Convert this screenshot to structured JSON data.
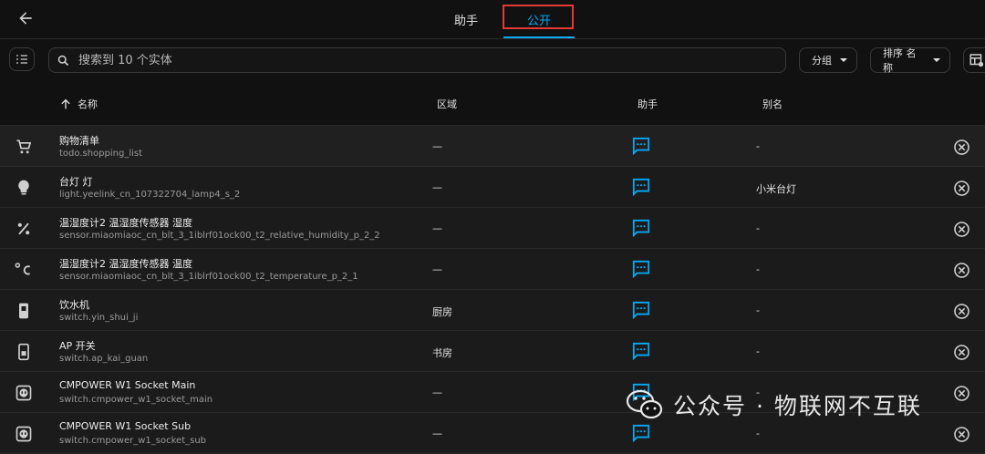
{
  "tabs": [
    {
      "label": "助手"
    },
    {
      "label": "公开"
    }
  ],
  "search": {
    "placeholder": "搜索到 10 个实体",
    "value": ""
  },
  "group_label": "分组",
  "sort_label": "排序 名称",
  "columns": {
    "name": "名称",
    "area": "区域",
    "assistant": "助手",
    "alias": "别名"
  },
  "rows": [
    {
      "icon": "cart-icon",
      "name": "购物清单",
      "entity_id": "todo.shopping_list",
      "area": "—",
      "alias": "-"
    },
    {
      "icon": "lightbulb-icon",
      "name": "台灯 灯",
      "entity_id": "light.yeelink_cn_107322704_lamp4_s_2",
      "area": "—",
      "alias": "小米台灯"
    },
    {
      "icon": "percent-icon",
      "name": "温湿度计2 温湿度传感器 湿度",
      "entity_id": "sensor.miaomiaoc_cn_blt_3_1iblrf01ock00_t2_relative_humidity_p_2_2",
      "area": "—",
      "alias": "-"
    },
    {
      "icon": "celsius-icon",
      "name": "温湿度计2 温湿度传感器 温度",
      "entity_id": "sensor.miaomiaoc_cn_blt_3_1iblrf01ock00_t2_temperature_p_2_1",
      "area": "—",
      "alias": "-"
    },
    {
      "icon": "switch-icon",
      "name": "饮水机",
      "entity_id": "switch.yin_shui_ji",
      "area": "厨房",
      "alias": "-"
    },
    {
      "icon": "phone-switch-icon",
      "name": "AP 开关",
      "entity_id": "switch.ap_kai_guan",
      "area": "书房",
      "alias": "-"
    },
    {
      "icon": "socket-icon",
      "name": "CMPOWER W1 Socket Main",
      "entity_id": "switch.cmpower_w1_socket_main",
      "area": "—",
      "alias": "-"
    },
    {
      "icon": "socket-icon",
      "name": "CMPOWER W1 Socket Sub",
      "entity_id": "switch.cmpower_w1_socket_sub",
      "area": "—",
      "alias": "-"
    }
  ],
  "watermark": {
    "text": "公众号 · 物联网不互联"
  },
  "colors": {
    "accent": "#03a9f4",
    "highlight_box": "#e53935",
    "background": "#111111"
  }
}
